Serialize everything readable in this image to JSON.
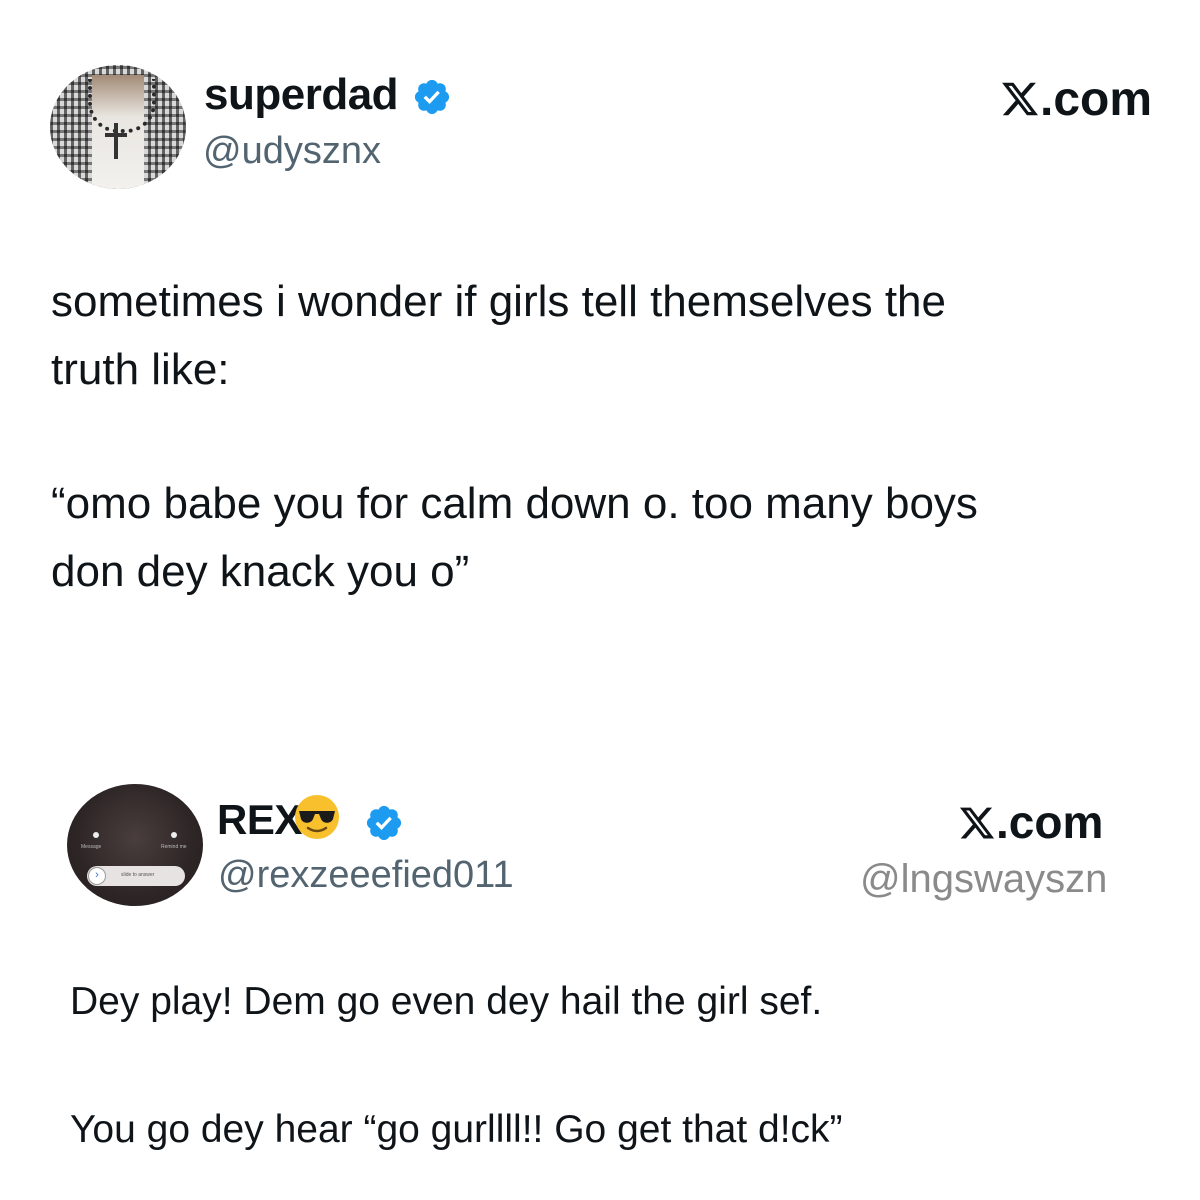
{
  "tweets": [
    {
      "name": "superdad",
      "handle": "@udysznx",
      "source": ".com",
      "text_line1": "sometimes i wonder if girls tell themselves the",
      "text_line2": "truth like:",
      "text_line3": "“omo babe you for calm down o. too many boys",
      "text_line4": "don dey knack you o”",
      "verified": true
    },
    {
      "name": "REX",
      "name_emoji": "smiling-face-with-sunglasses",
      "handle": "@rexzeeefied011",
      "source": ".com",
      "watermark": "@lngswayszn",
      "text_line1": "Dey play! Dem go even dey hail the girl sef.",
      "text_line2": "You go dey hear “go gurllll!! Go get that d!ck”",
      "verified": true
    }
  ],
  "colors": {
    "verified_badge": "#1d9bf0",
    "text": "#0f1419",
    "handle": "#536471",
    "watermark": "#8a8a8a"
  },
  "icons": [
    "x-logo-icon",
    "verified-badge-icon",
    "sunglasses-emoji-icon"
  ]
}
